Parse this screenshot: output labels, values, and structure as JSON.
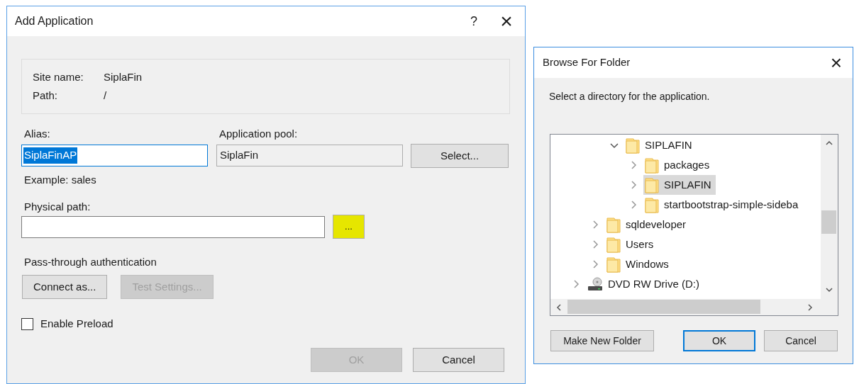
{
  "add_dialog": {
    "title": "Add Application",
    "help": "?",
    "close": "×",
    "site_name_label": "Site name:",
    "site_name": "SiplaFin",
    "path_label": "Path:",
    "path": "/",
    "alias": {
      "label": "Alias:",
      "value": "SiplaFinAP",
      "text_selected": true,
      "hint": "Example: sales"
    },
    "application_pool": {
      "label": "Application pool:",
      "value": "SiplaFin",
      "button": "Select..."
    },
    "physical_path": {
      "label": "Physical path:",
      "browse_button": "...",
      "highlighted": true
    },
    "pass_through": {
      "label": "Pass-through authentication",
      "buttons": [
        {
          "label": "Connect as...",
          "disabled": false
        },
        {
          "label": "Test Settings...",
          "disabled": true
        }
      ]
    },
    "enable_preload": {
      "label": "Enable Preload",
      "checked": false
    },
    "buttons": [
      {
        "label": "OK",
        "disabled": true
      },
      {
        "label": "Cancel",
        "disabled": false
      }
    ]
  },
  "browse_dialog": {
    "title": "Browse For Folder",
    "close": "×",
    "prompt": "Select a directory for the application.",
    "tree": {
      "items": [
        {
          "children": [
            {
              "children": [
                {
                  "label": "SIPLAFIN",
                  "kind": "folder",
                  "expanded": true,
                  "selected": false,
                  "children": [
                    {
                      "label": "packages",
                      "kind": "folder",
                      "expanded": false,
                      "selected": false
                    },
                    {
                      "label": "SIPLAFIN",
                      "kind": "folder",
                      "expanded": false,
                      "selected": true
                    },
                    {
                      "label": "startbootstrap-simple-sideba",
                      "kind": "folder",
                      "expanded": false,
                      "selected": false
                    }
                  ]
                }
              ]
            },
            {
              "label": "sqldeveloper",
              "kind": "folder",
              "expanded": false,
              "selected": false
            },
            {
              "label": "Users",
              "kind": "folder",
              "expanded": false,
              "selected": false
            },
            {
              "label": "Windows",
              "kind": "folder",
              "expanded": false,
              "selected": false
            }
          ]
        },
        {
          "label": "DVD RW Drive (D:)",
          "kind": "drive",
          "expanded": false,
          "selected": false
        }
      ]
    },
    "buttons": [
      {
        "label": "Make New Folder",
        "default": false
      },
      {
        "label": "OK",
        "default": true
      },
      {
        "label": "Cancel",
        "default": false
      }
    ]
  }
}
